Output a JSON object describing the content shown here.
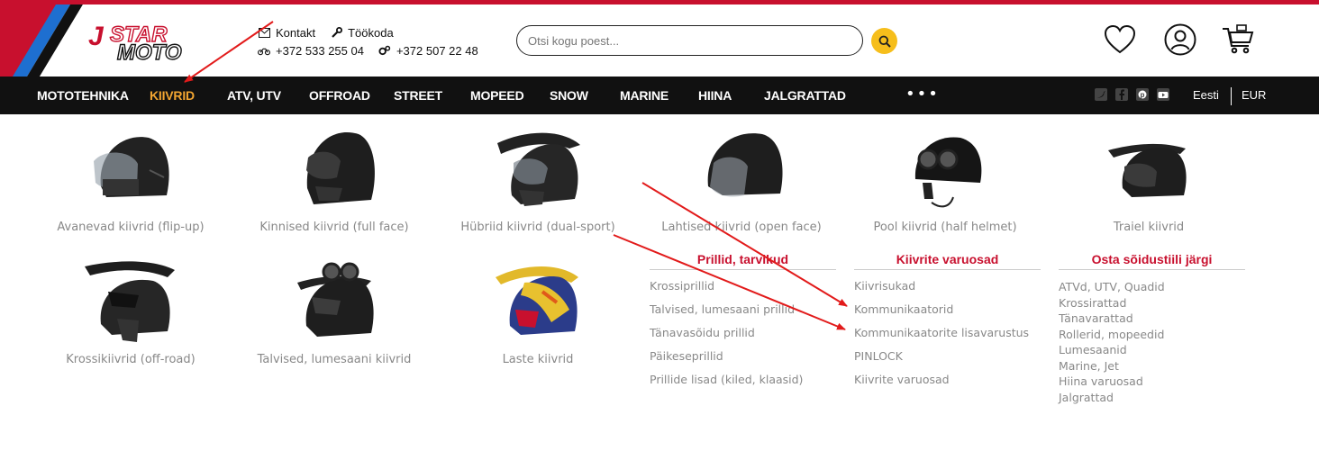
{
  "header": {
    "contact_label": "Kontakt",
    "workshop_label": "Töökoda",
    "phone_moto": "+372 533 255 04",
    "phone_service": "+372 507 22 48",
    "search_placeholder": "Otsi kogu poest...",
    "icons": [
      "envelope-icon",
      "wrench-icon",
      "motorcycle-icon",
      "gears-icon",
      "search-icon",
      "heart-icon",
      "user-icon",
      "cart-icon"
    ]
  },
  "logo_text": "STAR MOTO",
  "nav": {
    "items": [
      "MOTOTEHNIKA",
      "KIIVRID",
      "ATV, UTV",
      "OFFROAD",
      "STREET",
      "MOPEED",
      "SNOW",
      "MARINE",
      "HIINA",
      "JALGRATTAD"
    ],
    "active": "KIIVRID",
    "more": "•••",
    "language": "Eesti",
    "currency": "EUR",
    "social_icons": [
      "twitter-icon",
      "facebook-icon",
      "pinterest-icon",
      "youtube-icon"
    ]
  },
  "categories": [
    {
      "label": "Avanevad kiivrid (flip-up)"
    },
    {
      "label": "Kinnised kiivrid (full face)"
    },
    {
      "label": "Hübriid kiivrid (dual-sport)"
    },
    {
      "label": "Lahtised kiivrid (open face)"
    },
    {
      "label": "Pool kiivrid (half helmet)"
    },
    {
      "label": "Traiel kiivrid"
    },
    {
      "label": "Krossikiivrid (off-road)"
    },
    {
      "label": "Talvised, lumesaani kiivrid"
    },
    {
      "label": "Laste kiivrid"
    }
  ],
  "columns": [
    {
      "title": "Prillid, tarvikud",
      "items": [
        "Krossiprillid",
        "Talvised, lumesaani prillid",
        "Tänavasõidu prillid",
        "Päikeseprillid",
        "Prillide lisad (kiled, klaasid)"
      ]
    },
    {
      "title": "Kiivrite varuosad",
      "items": [
        "Kiivrisukad",
        "Kommunikaatorid",
        "Kommunikaatorite lisavarustus",
        "PINLOCK",
        "Kiivrite varuosad"
      ]
    },
    {
      "title": "Osta sõidustiili järgi",
      "items": [
        "ATVd, UTV, Quadid",
        "Krossirattad",
        "Tänavarattad",
        "Rollerid, mopeedid",
        "Lumesaanid",
        "Marine, Jet",
        "Hiina varuosad",
        "Jalgrattad"
      ]
    }
  ],
  "colors": {
    "brand_red": "#c8102e",
    "nav_bg": "#111111",
    "active_nav": "#f2a531",
    "search_button": "#f6be1b"
  }
}
